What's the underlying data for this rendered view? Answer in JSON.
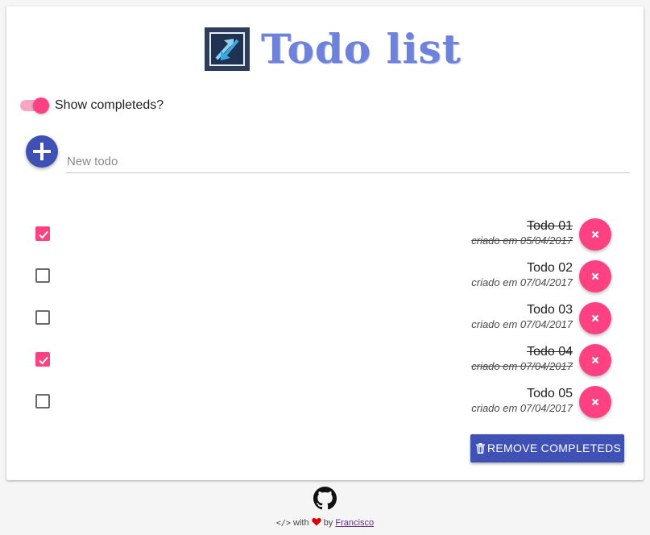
{
  "header": {
    "title": "Todo list",
    "logo_icon": "expand-arrows-logo-icon"
  },
  "controls": {
    "show_completed_label": "Show completeds?",
    "show_completed_on": true,
    "new_todo_placeholder": "New todo",
    "new_todo_value": ""
  },
  "todos": [
    {
      "title": "Todo 01",
      "date": "criado em 05/04/2017",
      "done": true
    },
    {
      "title": "Todo 02",
      "date": "criado em 07/04/2017",
      "done": false
    },
    {
      "title": "Todo 03",
      "date": "criado em 07/04/2017",
      "done": false
    },
    {
      "title": "Todo 04",
      "date": "criado em 07/04/2017",
      "done": true
    },
    {
      "title": "Todo 05",
      "date": "criado em 07/04/2017",
      "done": false
    }
  ],
  "actions": {
    "remove_completed_label": "REMOVE COMPLETEDS"
  },
  "footer": {
    "code_glyph": "</>",
    "with_text": "with",
    "by_text": "by",
    "author": "Francisco"
  },
  "colors": {
    "primary": "#3f51b5",
    "accent": "#ff4081",
    "title": "#6d82d8"
  }
}
